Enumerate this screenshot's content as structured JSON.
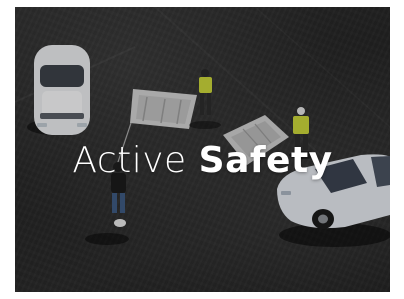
{
  "hero": {
    "headline_light": "Active",
    "headline_bold": "Safety"
  },
  "colors": {
    "asphalt": "#2b2b2b",
    "car_white": "#eceef0",
    "car_blue_white": "#dfe4ea",
    "safety_vest": "#c9d43a",
    "headline": "#ffffff"
  }
}
